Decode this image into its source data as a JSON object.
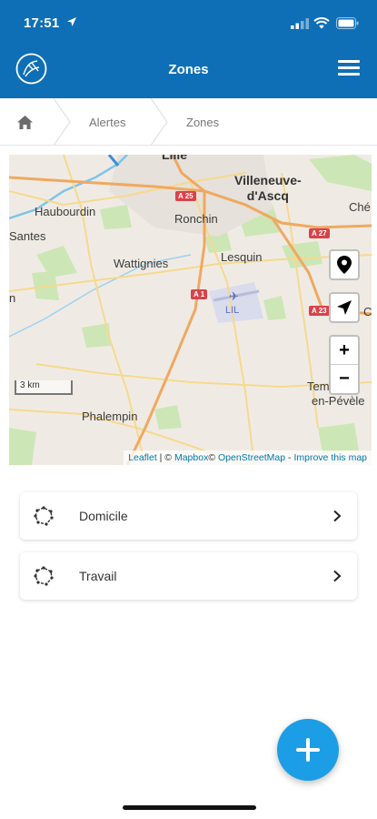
{
  "status_bar": {
    "time": "17:51"
  },
  "header": {
    "title": "Zones",
    "menu_icon": "hamburger-menu-icon",
    "logo_icon": "app-logo-icon"
  },
  "breadcrumb": {
    "home_icon": "home-icon",
    "items": [
      "Alertes",
      "Zones"
    ]
  },
  "map": {
    "labels": {
      "lille": "Lille",
      "villeneuve": "Villeneuve-\nd'Ascq",
      "haubourdin": "Haubourdin",
      "ronchin": "Ronchin",
      "santes": "Santes",
      "wattignies": "Wattignies",
      "lesquin": "Lesquin",
      "lil": "LIL",
      "phalempin": "Phalempin",
      "templeuve": "Tem",
      "enpevele": "en-Pévèle",
      "che": "Ché",
      "c": "C",
      "n": "n"
    },
    "shields": [
      "A 25",
      "A 27",
      "A 1",
      "A 23"
    ],
    "scale": "3 km",
    "attribution": {
      "leaflet": "Leaflet",
      "sep": " | © ",
      "mapbox": "Mapbox",
      "osm_prefix": "© ",
      "osm": "OpenStreetMap",
      "dash": " - ",
      "improve": "Improve this map"
    },
    "controls": {
      "zoom_in": "+",
      "zoom_out": "−"
    }
  },
  "zones": [
    {
      "label": "Domicile"
    },
    {
      "label": "Travail"
    }
  ],
  "fab": {
    "icon": "plus-icon"
  },
  "colors": {
    "header": "#0e6fb6",
    "fab": "#1c9ee6"
  }
}
